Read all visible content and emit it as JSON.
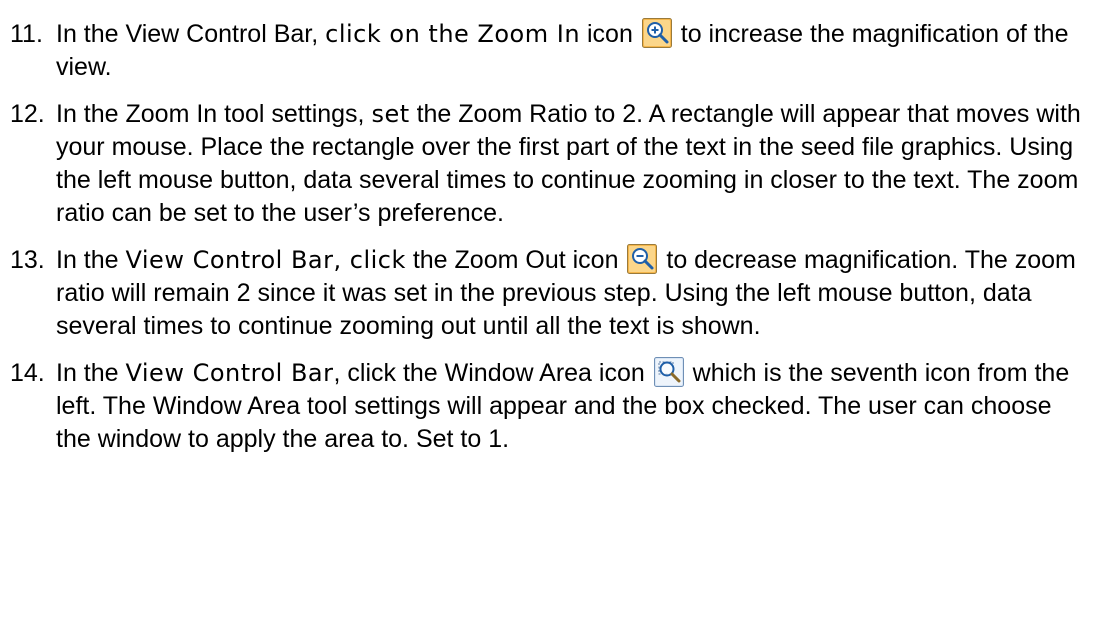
{
  "steps": [
    {
      "number": "11.",
      "parts": {
        "a": "In the View Control Bar, ",
        "b": "click on the Zoom In",
        "c": " icon ",
        "d": " to increase the magnification of the view."
      },
      "icon": "zoom-in-icon"
    },
    {
      "number": "12.",
      "parts": {
        "a": "In the Zoom In tool settings, ",
        "b": "set",
        "c": " the Zoom Ratio to 2. A rectangle will appear that moves with your mouse. Place the rectangle over the first part of the text in the seed file graphics. Using the left mouse button, data several times to continue zooming in closer to the text.  The zoom ratio can be set to the user’s preference."
      }
    },
    {
      "number": "13.",
      "parts": {
        "a": "In the ",
        "b": "View Control Bar, click",
        "c": " the Zoom Out icon ",
        "d": " to decrease magnification. The zoom ratio will remain 2 since it was set in the previous step. Using the left mouse button, data several times to continue zooming out until all the text is shown."
      },
      "icon": "zoom-out-icon"
    },
    {
      "number": "14.",
      "parts": {
        "a": "In the ",
        "b": "View Control Bar",
        "c": ", click the Window Area icon ",
        "d": " which is the seventh icon from the left. The Window Area tool settings will appear and the box checked. The user can choose the window to apply the area to. Set to 1."
      },
      "icon": "window-area-icon"
    }
  ],
  "colors": {
    "text": "#000000",
    "icon_orange": "#f5b64a",
    "icon_border": "#9a7a3a",
    "icon_blue": "#1f5fa8",
    "window_icon_bg": "#d9e6f5"
  }
}
